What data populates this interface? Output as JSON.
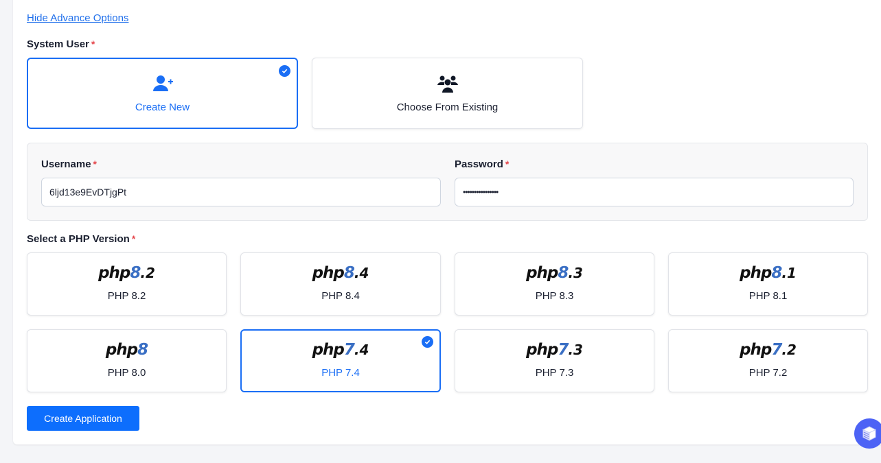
{
  "advanced": {
    "toggle_label": "Hide Advance Options"
  },
  "system_user": {
    "label": "System User",
    "required_mark": "*",
    "options": [
      {
        "label": "Create New",
        "icon": "user-plus-icon",
        "selected": true
      },
      {
        "label": "Choose From Existing",
        "icon": "users-icon",
        "selected": false
      }
    ]
  },
  "credentials": {
    "username": {
      "label": "Username",
      "required_mark": "*",
      "value": "6ljd13e9EvDTjgPt"
    },
    "password": {
      "label": "Password",
      "required_mark": "*",
      "value": "••••••••••••••••"
    }
  },
  "php": {
    "label": "Select a PHP Version",
    "required_mark": "*",
    "versions": [
      {
        "logo_major": "8",
        "logo_minor": ".2",
        "label": "PHP 8.2",
        "selected": false
      },
      {
        "logo_major": "8",
        "logo_minor": ".4",
        "label": "PHP 8.4",
        "selected": false
      },
      {
        "logo_major": "8",
        "logo_minor": ".3",
        "label": "PHP 8.3",
        "selected": false
      },
      {
        "logo_major": "8",
        "logo_minor": ".1",
        "label": "PHP 8.1",
        "selected": false
      },
      {
        "logo_major": "8",
        "logo_minor": "",
        "label": "PHP 8.0",
        "selected": false
      },
      {
        "logo_major": "7",
        "logo_minor": ".4",
        "label": "PHP 7.4",
        "selected": true
      },
      {
        "logo_major": "7",
        "logo_minor": ".3",
        "label": "PHP 7.3",
        "selected": false
      },
      {
        "logo_major": "7",
        "logo_minor": ".2",
        "label": "PHP 7.2",
        "selected": false
      }
    ],
    "logo_prefix": "php"
  },
  "actions": {
    "create_label": "Create Application"
  },
  "colors": {
    "accent": "#1a6ef5",
    "button": "#0d6efd",
    "required": "#e5484d",
    "fab": "#4d63f5"
  }
}
